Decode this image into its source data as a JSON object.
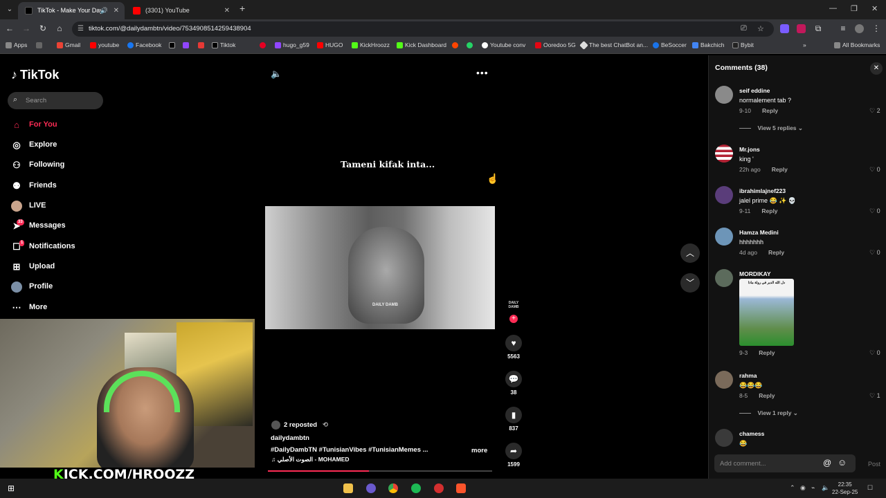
{
  "browser": {
    "tabs": [
      {
        "title": "TikTok - Make Your Day",
        "active": true
      },
      {
        "title": "(3301) YouTube",
        "active": false
      }
    ],
    "url": "tiktok.com/@dailydambtn/video/7534908514259438904",
    "bookmarks": [
      "Apps",
      "Gmail",
      "youtube",
      "Facebook",
      "",
      "",
      "",
      "Tiktok",
      "",
      "hugo_g59",
      "HUGO",
      "KickHroozz",
      "Kick Dashboard",
      "",
      "",
      "Youtube conv",
      "Ooredoo 5G",
      "The best ChatBot an...",
      "BeSoccer",
      "Bakchich",
      "Bybit"
    ],
    "all_bookmarks": "All Bookmarks"
  },
  "sidebar": {
    "logo": "TikTok",
    "search_placeholder": "Search",
    "items": [
      {
        "label": "For You",
        "icon": "home-icon",
        "active": true
      },
      {
        "label": "Explore",
        "icon": "compass-icon"
      },
      {
        "label": "Following",
        "icon": "following-icon"
      },
      {
        "label": "Friends",
        "icon": "friends-icon"
      },
      {
        "label": "LIVE",
        "icon": "live-icon"
      },
      {
        "label": "Messages",
        "icon": "messages-icon",
        "badge": "33"
      },
      {
        "label": "Notifications",
        "icon": "notifications-icon",
        "badge": "1"
      },
      {
        "label": "Upload",
        "icon": "upload-icon"
      },
      {
        "label": "Profile",
        "icon": "profile-icon"
      },
      {
        "label": "More",
        "icon": "more-icon"
      }
    ]
  },
  "webcam_overlay": {
    "text_prefix": "K",
    "text_rest": "ICK.COM/HROOZZ"
  },
  "video": {
    "caption_overlay": "Tameni kifak inta...",
    "watermark": "DAILY DAMB",
    "avatar_text": "DAILY DAMB",
    "likes": "5563",
    "comments": "38",
    "saves": "837",
    "shares": "1599",
    "reposted": "2 reposted",
    "author": "dailydambtn",
    "hashtags": "#DailyDambTN  #TunisianVibes  #TunisianMemes  ...",
    "more": "more",
    "music": "♫ الصوت الأصلي - MOHAMED",
    "progress": 0.45
  },
  "comments_panel": {
    "title": "Comments (38)",
    "comments": [
      {
        "user": "seif eddine",
        "text": "normalement tab ?",
        "date": "9-10",
        "likes": "2",
        "view_replies": "View 5 replies ⌄"
      },
      {
        "user": "Mr.jons",
        "text": "king '",
        "date": "22h ago",
        "likes": "0"
      },
      {
        "user": "ibrahimlajnef223",
        "text": "jalel prime 😂 ✨ 💀",
        "date": "9-11",
        "likes": "0"
      },
      {
        "user": "Hamza Medini",
        "text": "hhhhhhh",
        "date": "4d ago",
        "likes": "0"
      },
      {
        "user": "MORDIKAY",
        "text": "",
        "date": "9-3",
        "likes": "0",
        "sticker_text": "دل الله الدبر في رولة ماذا"
      },
      {
        "user": "rahma",
        "text": "😂😂😂",
        "date": "8-5",
        "likes": "1",
        "view_replies": "View 1 reply ⌄"
      },
      {
        "user": "chamess",
        "text": "😂",
        "date": "",
        "likes": ""
      }
    ],
    "reply_label": "Reply",
    "add_placeholder": "Add comment...",
    "post_label": "Post"
  },
  "taskbar": {
    "time": "22:35",
    "date": "22-Sep-25"
  }
}
